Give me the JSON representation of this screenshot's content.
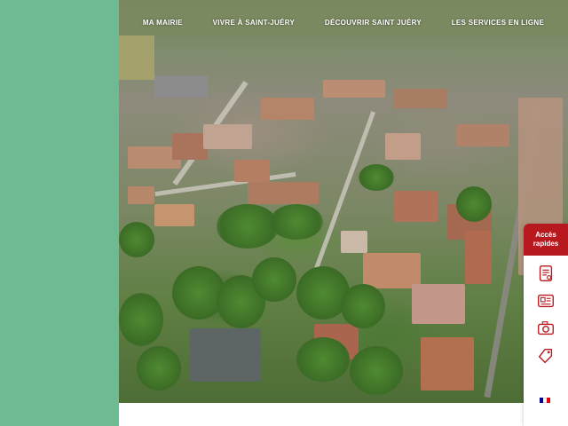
{
  "nav": {
    "items": [
      {
        "label": "MA MAIRIE"
      },
      {
        "label": "VIVRE À SAINT-JUÉRY"
      },
      {
        "label": "DÉCOUVRIR SAINT JUÉRY"
      },
      {
        "label": "LES SERVICES EN LIGNE"
      }
    ]
  },
  "quick_access": {
    "title_line1": "Accès",
    "title_line2": "rapides",
    "items": [
      {
        "icon": "document-form-icon"
      },
      {
        "icon": "news-icon"
      },
      {
        "icon": "camera-icon"
      },
      {
        "icon": "tag-icon"
      }
    ]
  },
  "colors": {
    "left_panel": "#6dba93",
    "accent_red": "#b8191f",
    "nav_text": "#ffffff"
  },
  "footer_logo": {
    "icon": "republique-francaise-logo-icon"
  }
}
